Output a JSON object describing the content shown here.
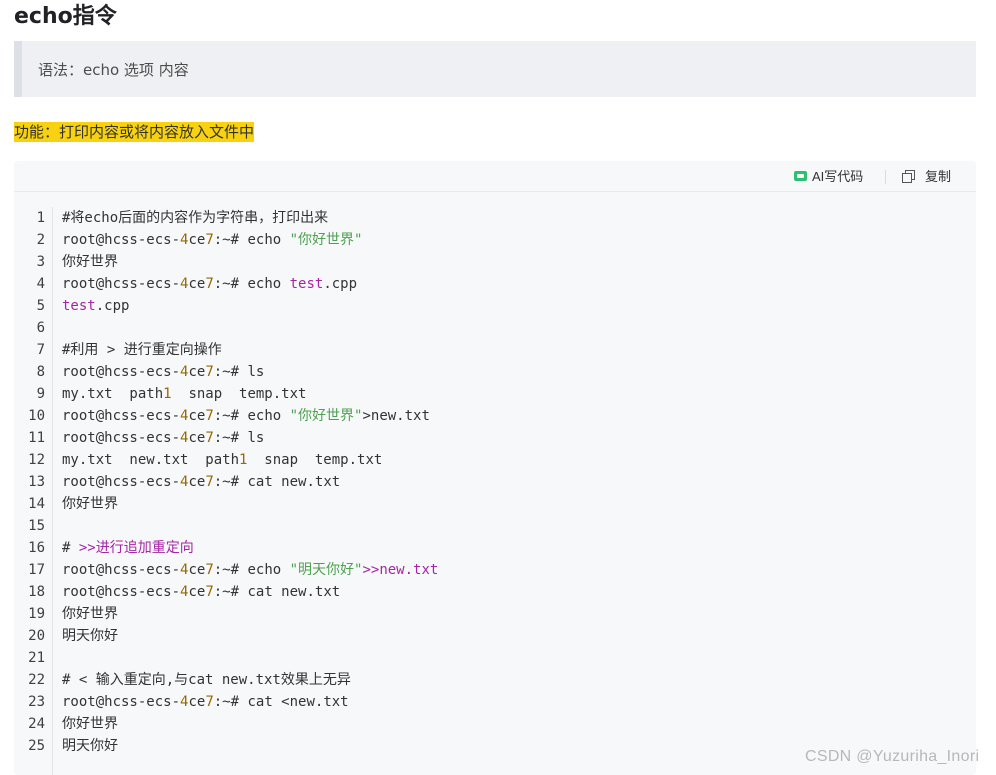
{
  "title": "echo指令",
  "syntax": "语法：echo  选项  内容",
  "feature": "功能：打印内容或将内容放入文件中",
  "toolbar": {
    "ai_label": "AI写代码",
    "copy_label": "复制"
  },
  "code_lines": [
    {
      "n": "1",
      "segs": [
        [
          "#将echo后面的内容作为字符串，打印出来",
          "cm"
        ]
      ]
    },
    {
      "n": "2",
      "segs": [
        [
          "root@hcss-ecs-",
          ""
        ],
        [
          "4",
          "n"
        ],
        [
          "ce",
          ""
        ],
        [
          "7",
          "n"
        ],
        [
          ":~# echo ",
          ""
        ],
        [
          "\"你好世界\"",
          "s"
        ]
      ]
    },
    {
      "n": "3",
      "segs": [
        [
          "你好世界",
          ""
        ]
      ]
    },
    {
      "n": "4",
      "segs": [
        [
          "root@hcss-ecs-",
          ""
        ],
        [
          "4",
          "n"
        ],
        [
          "ce",
          ""
        ],
        [
          "7",
          "n"
        ],
        [
          ":~# echo ",
          ""
        ],
        [
          "test",
          "p"
        ],
        [
          ".cpp",
          ""
        ]
      ]
    },
    {
      "n": "5",
      "segs": [
        [
          "test",
          "p"
        ],
        [
          ".cpp",
          ""
        ]
      ]
    },
    {
      "n": "6",
      "segs": []
    },
    {
      "n": "7",
      "segs": [
        [
          "#利用 > 进行重定向操作",
          "cm"
        ]
      ]
    },
    {
      "n": "8",
      "segs": [
        [
          "root@hcss-ecs-",
          ""
        ],
        [
          "4",
          "n"
        ],
        [
          "ce",
          ""
        ],
        [
          "7",
          "n"
        ],
        [
          ":~# ls",
          ""
        ]
      ]
    },
    {
      "n": "9",
      "segs": [
        [
          "my.txt  path",
          ""
        ],
        [
          "1",
          "n"
        ],
        [
          "  snap  temp.txt",
          ""
        ]
      ]
    },
    {
      "n": "10",
      "segs": [
        [
          "root@hcss-ecs-",
          ""
        ],
        [
          "4",
          "n"
        ],
        [
          "ce",
          ""
        ],
        [
          "7",
          "n"
        ],
        [
          ":~# echo ",
          ""
        ],
        [
          "\"你好世界\"",
          "s"
        ],
        [
          ">new.txt",
          ""
        ]
      ]
    },
    {
      "n": "11",
      "segs": [
        [
          "root@hcss-ecs-",
          ""
        ],
        [
          "4",
          "n"
        ],
        [
          "ce",
          ""
        ],
        [
          "7",
          "n"
        ],
        [
          ":~# ls",
          ""
        ]
      ]
    },
    {
      "n": "12",
      "segs": [
        [
          "my.txt  new.txt  path",
          ""
        ],
        [
          "1",
          "n"
        ],
        [
          "  snap  temp.txt",
          ""
        ]
      ]
    },
    {
      "n": "13",
      "segs": [
        [
          "root@hcss-ecs-",
          ""
        ],
        [
          "4",
          "n"
        ],
        [
          "ce",
          ""
        ],
        [
          "7",
          "n"
        ],
        [
          ":~# cat new.txt",
          ""
        ]
      ]
    },
    {
      "n": "14",
      "segs": [
        [
          "你好世界",
          ""
        ]
      ]
    },
    {
      "n": "15",
      "segs": []
    },
    {
      "n": "16",
      "segs": [
        [
          "# ",
          ""
        ],
        [
          ">>进行追加重定向",
          "p"
        ]
      ]
    },
    {
      "n": "17",
      "segs": [
        [
          "root@hcss-ecs-",
          ""
        ],
        [
          "4",
          "n"
        ],
        [
          "ce",
          ""
        ],
        [
          "7",
          "n"
        ],
        [
          ":~# echo ",
          ""
        ],
        [
          "\"明天你好\"",
          "s"
        ],
        [
          ">>new.txt",
          "p"
        ]
      ]
    },
    {
      "n": "18",
      "segs": [
        [
          "root@hcss-ecs-",
          ""
        ],
        [
          "4",
          "n"
        ],
        [
          "ce",
          ""
        ],
        [
          "7",
          "n"
        ],
        [
          ":~# cat new.txt",
          ""
        ]
      ]
    },
    {
      "n": "19",
      "segs": [
        [
          "你好世界",
          ""
        ]
      ]
    },
    {
      "n": "20",
      "segs": [
        [
          "明天你好",
          ""
        ]
      ]
    },
    {
      "n": "21",
      "segs": []
    },
    {
      "n": "22",
      "segs": [
        [
          "# < 输入重定向,与cat new.txt效果上无异",
          "cm"
        ]
      ]
    },
    {
      "n": "23",
      "segs": [
        [
          "root@hcss-ecs-",
          ""
        ],
        [
          "4",
          "n"
        ],
        [
          "ce",
          ""
        ],
        [
          "7",
          "n"
        ],
        [
          ":~# cat <new.txt",
          ""
        ]
      ]
    },
    {
      "n": "24",
      "segs": [
        [
          "你好世界",
          ""
        ]
      ]
    },
    {
      "n": "25",
      "segs": [
        [
          "明天你好",
          ""
        ]
      ]
    }
  ],
  "watermark": "CSDN @Yuzuriha_Inori"
}
